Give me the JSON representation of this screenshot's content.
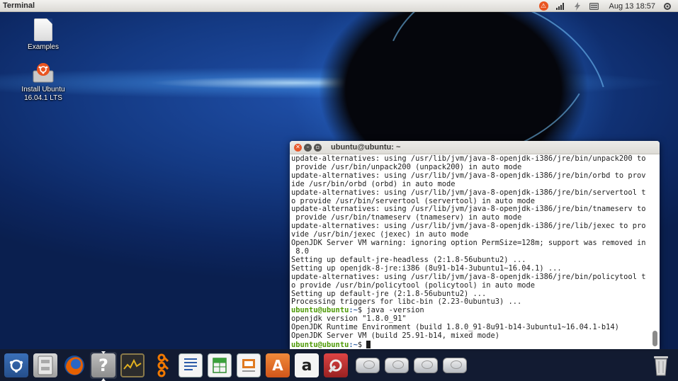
{
  "panel": {
    "app_title": "Terminal",
    "clock": "Aug 13 18:57"
  },
  "desktop": {
    "icons": [
      {
        "label": "Examples",
        "icon": "file-icon"
      },
      {
        "label": "Install Ubuntu\n16.04.1 LTS",
        "icon": "installer-icon"
      }
    ]
  },
  "terminal": {
    "title": "ubuntu@ubuntu: ~",
    "prompt_user": "ubuntu@ubuntu",
    "prompt_path": ":~",
    "prompt_symbol": "$ ",
    "lines": [
      "update-alternatives: using /usr/lib/jvm/java-8-openjdk-i386/jre/bin/unpack200 to",
      " provide /usr/bin/unpack200 (unpack200) in auto mode",
      "update-alternatives: using /usr/lib/jvm/java-8-openjdk-i386/jre/bin/orbd to prov",
      "ide /usr/bin/orbd (orbd) in auto mode",
      "update-alternatives: using /usr/lib/jvm/java-8-openjdk-i386/jre/bin/servertool t",
      "o provide /usr/bin/servertool (servertool) in auto mode",
      "update-alternatives: using /usr/lib/jvm/java-8-openjdk-i386/jre/bin/tnameserv to",
      " provide /usr/bin/tnameserv (tnameserv) in auto mode",
      "update-alternatives: using /usr/lib/jvm/java-8-openjdk-i386/jre/lib/jexec to pro",
      "vide /usr/bin/jexec (jexec) in auto mode",
      "OpenJDK Server VM warning: ignoring option PermSize=128m; support was removed in",
      " 8.0",
      "Setting up default-jre-headless (2:1.8-56ubuntu2) ...",
      "Setting up openjdk-8-jre:i386 (8u91-b14-3ubuntu1~16.04.1) ...",
      "update-alternatives: using /usr/lib/jvm/java-8-openjdk-i386/jre/bin/policytool t",
      "o provide /usr/bin/policytool (policytool) in auto mode",
      "Setting up default-jre (2:1.8-56ubuntu2) ...",
      "Processing triggers for libc-bin (2.23-0ubuntu3) ..."
    ],
    "command": "java -version",
    "output": [
      "openjdk version \"1.8.0_91\"",
      "OpenJDK Runtime Environment (build 1.8.0_91-8u91-b14-3ubuntu1~16.04.1-b14)",
      "OpenJDK Server VM (build 25.91-b14, mixed mode)"
    ]
  },
  "launcher": {
    "items": [
      {
        "name": "ubuntu-dash",
        "icon": "ubuntu-logo-icon"
      },
      {
        "name": "files",
        "icon": "file-cabinet-icon"
      },
      {
        "name": "firefox",
        "icon": "firefox-icon"
      },
      {
        "name": "help",
        "icon": "question-mark-icon",
        "glyph": "?"
      },
      {
        "name": "system-monitor",
        "icon": "system-monitor-icon"
      },
      {
        "name": "bluetooth",
        "icon": "bluetooth-icon"
      },
      {
        "name": "libreoffice-writer",
        "icon": "writer-icon"
      },
      {
        "name": "libreoffice-calc",
        "icon": "calc-icon"
      },
      {
        "name": "libreoffice-impress",
        "icon": "impress-icon"
      },
      {
        "name": "software-center",
        "icon": "software-center-icon",
        "glyph": "A"
      },
      {
        "name": "amazon",
        "icon": "amazon-icon",
        "glyph": "a"
      },
      {
        "name": "system-settings",
        "icon": "settings-icon"
      },
      {
        "name": "drive-1",
        "icon": "drive-icon"
      },
      {
        "name": "drive-2",
        "icon": "drive-icon"
      },
      {
        "name": "drive-3",
        "icon": "drive-icon"
      },
      {
        "name": "drive-4",
        "icon": "drive-icon"
      },
      {
        "name": "trash",
        "icon": "trash-icon"
      }
    ]
  }
}
